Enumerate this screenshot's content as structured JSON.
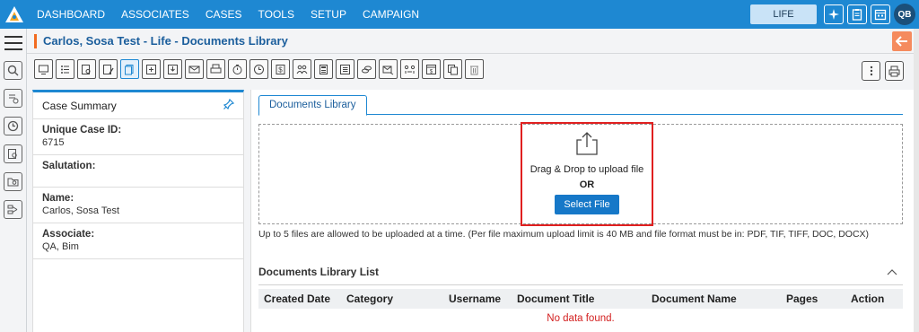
{
  "nav": {
    "items": [
      "DASHBOARD",
      "ASSOCIATES",
      "CASES",
      "TOOLS",
      "SETUP",
      "CAMPAIGN"
    ],
    "active": "CASES",
    "product": "LIFE",
    "user_initials": "QB"
  },
  "page": {
    "title": "Carlos, Sosa Test - Life - Documents Library"
  },
  "toolbar": {
    "icons": [
      "monitor-icon",
      "list-icon",
      "search-doc-icon",
      "edit-doc-icon",
      "documents-icon",
      "add-doc-icon",
      "download-icon",
      "email-icon",
      "print-icon",
      "timer-icon",
      "clock-icon",
      "dollar-icon",
      "people-icon",
      "calculator-icon",
      "checklist-icon",
      "coins-icon",
      "mail-send-icon",
      "transfer-icon",
      "invoice-icon",
      "copy-icon",
      "trash-icon"
    ],
    "active_index": 4,
    "right_icons": [
      "more-icon",
      "print-icon"
    ]
  },
  "summary": {
    "heading": "Case Summary",
    "fields": [
      {
        "label": "Unique Case ID:",
        "value": "6715"
      },
      {
        "label": "Salutation:",
        "value": ""
      },
      {
        "label": "Name:",
        "value": "Carlos, Sosa Test"
      },
      {
        "label": "Associate:",
        "value": "QA, Bim"
      }
    ]
  },
  "documents": {
    "tab": "Documents Library",
    "drag_text": "Drag & Drop to upload file",
    "or_text": "OR",
    "select_button": "Select File",
    "hint": "Up to 5 files are allowed to be uploaded at a time. (Per file maximum upload limit is 40 MB and file format must be in: PDF, TIF, TIFF, DOC, DOCX)",
    "list_title": "Documents Library List",
    "columns": [
      "Created Date",
      "Category",
      "Username",
      "Document Title",
      "Document Name",
      "Pages",
      "Action"
    ],
    "empty_message": "No data found."
  },
  "colors": {
    "brand": "#1e88d2",
    "accent": "#f26b21",
    "highlight": "#e02020"
  }
}
